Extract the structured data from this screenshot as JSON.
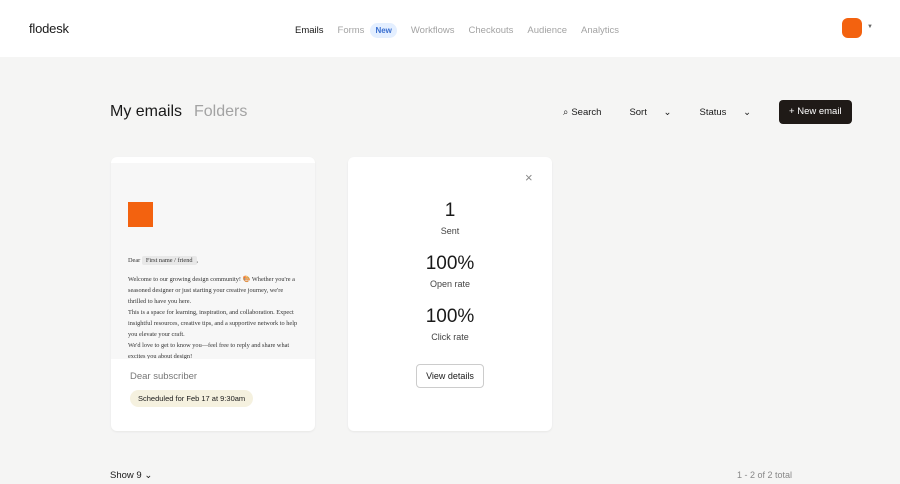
{
  "header": {
    "logo": "flodesk",
    "nav": [
      "Emails",
      "Forms",
      "Workflows",
      "Checkouts",
      "Audience",
      "Analytics"
    ],
    "new_badge": "New"
  },
  "page": {
    "title": "My emails",
    "folders": "Folders",
    "search": "Search",
    "sort": "Sort",
    "status": "Status",
    "new_email": "+  New email"
  },
  "email": {
    "dear": "Dear",
    "tag": "First name / friend",
    "comma": ",",
    "body": [
      "Welcome to our growing design community! 🎨 Whether you're a seasoned designer or just starting your creative journey, we're thrilled to have you here.",
      "This is a space for learning, inspiration, and collaboration. Expect insightful resources, creative tips, and a supportive network to help you elevate your craft.",
      "We'd love to get to know you—feel free to reply and share what excites you about design!"
    ],
    "subject": "Dear subscriber",
    "scheduled": "Scheduled for Feb 17 at 9:30am"
  },
  "stats": {
    "sent": "1",
    "sent_label": "Sent",
    "open": "100%",
    "open_label": "Open rate",
    "click": "100%",
    "click_label": "Click rate",
    "view": "View details",
    "close": "×"
  },
  "footer": {
    "show": "Show 9 ⌄",
    "total": "1 - 2 of 2 total"
  }
}
